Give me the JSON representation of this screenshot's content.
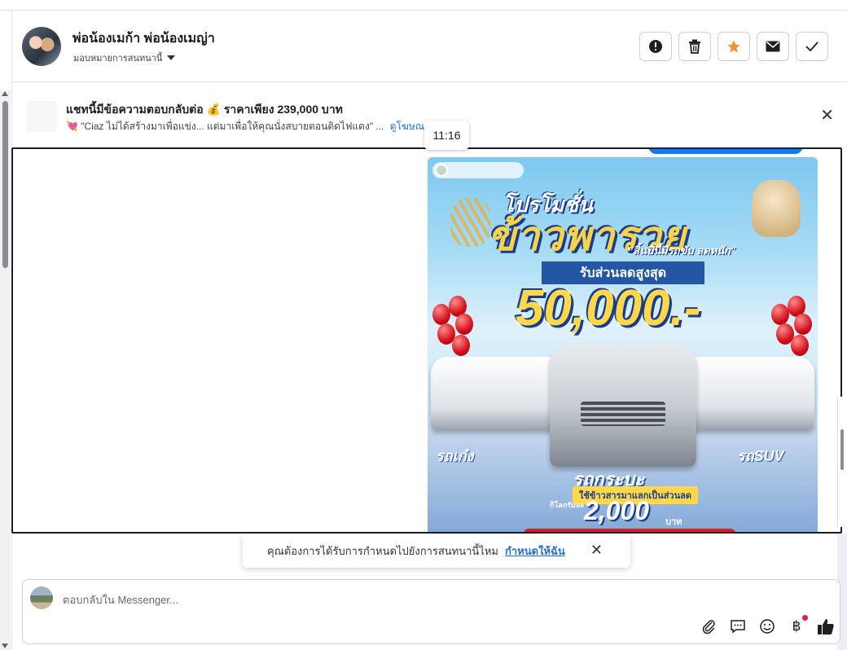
{
  "header": {
    "name": "พ่อน้องเมก้า พ่อน้องเมญ่า",
    "assign_label": "มอบหมายการสนทนานี้",
    "icons": [
      "alert-icon",
      "trash-icon",
      "star-icon",
      "mail-icon",
      "check-icon"
    ],
    "colors": {
      "star": "#f5922b"
    }
  },
  "ad": {
    "title": "แชทนี้มีข้อความตอบกลับต่อ 💰 ราคาเพียง 239,000 บาท",
    "description": "💘 \"Ciaz ไม่ได้สร้างมาเพื่อแข่ง... แต่มาเพื่อให้คุณนั่งสบายตอนติดไฟแดง\" ...",
    "link": "ดูโฆษณา"
  },
  "conversation": {
    "time": "11:16",
    "promo": {
      "headline_top": "โปรโมชั่น",
      "headline_main": "ข้าวพารวย",
      "tagline": "\"สิ้นปีนี้มีรถขับ ลดหนัก\"",
      "ribbon": "รับส่วนลดสูงสุด",
      "amount": "50,000.-",
      "label_sedan": "รถเก๋ง",
      "label_suv": "รถSUV",
      "label_pickup": "รถกระบะ",
      "exchange": "ใช้ข้าวสารมาแลกเป็นส่วนลด",
      "per_kg": "กิโลกรัมละ",
      "price": "2,000",
      "baht": "บาท"
    }
  },
  "toast": {
    "text": "คุณต้องการได้รับการกำหนดไปยังการสนทนานี้ไหม",
    "link": "กำหนดให้ฉัน"
  },
  "composer": {
    "placeholder": "ตอบกลับใน Messenger...",
    "tools": [
      "attach-icon",
      "chat-icon",
      "emoji-icon",
      "baht-icon",
      "like-icon"
    ],
    "colors": {
      "like": "#0a7cff"
    }
  }
}
